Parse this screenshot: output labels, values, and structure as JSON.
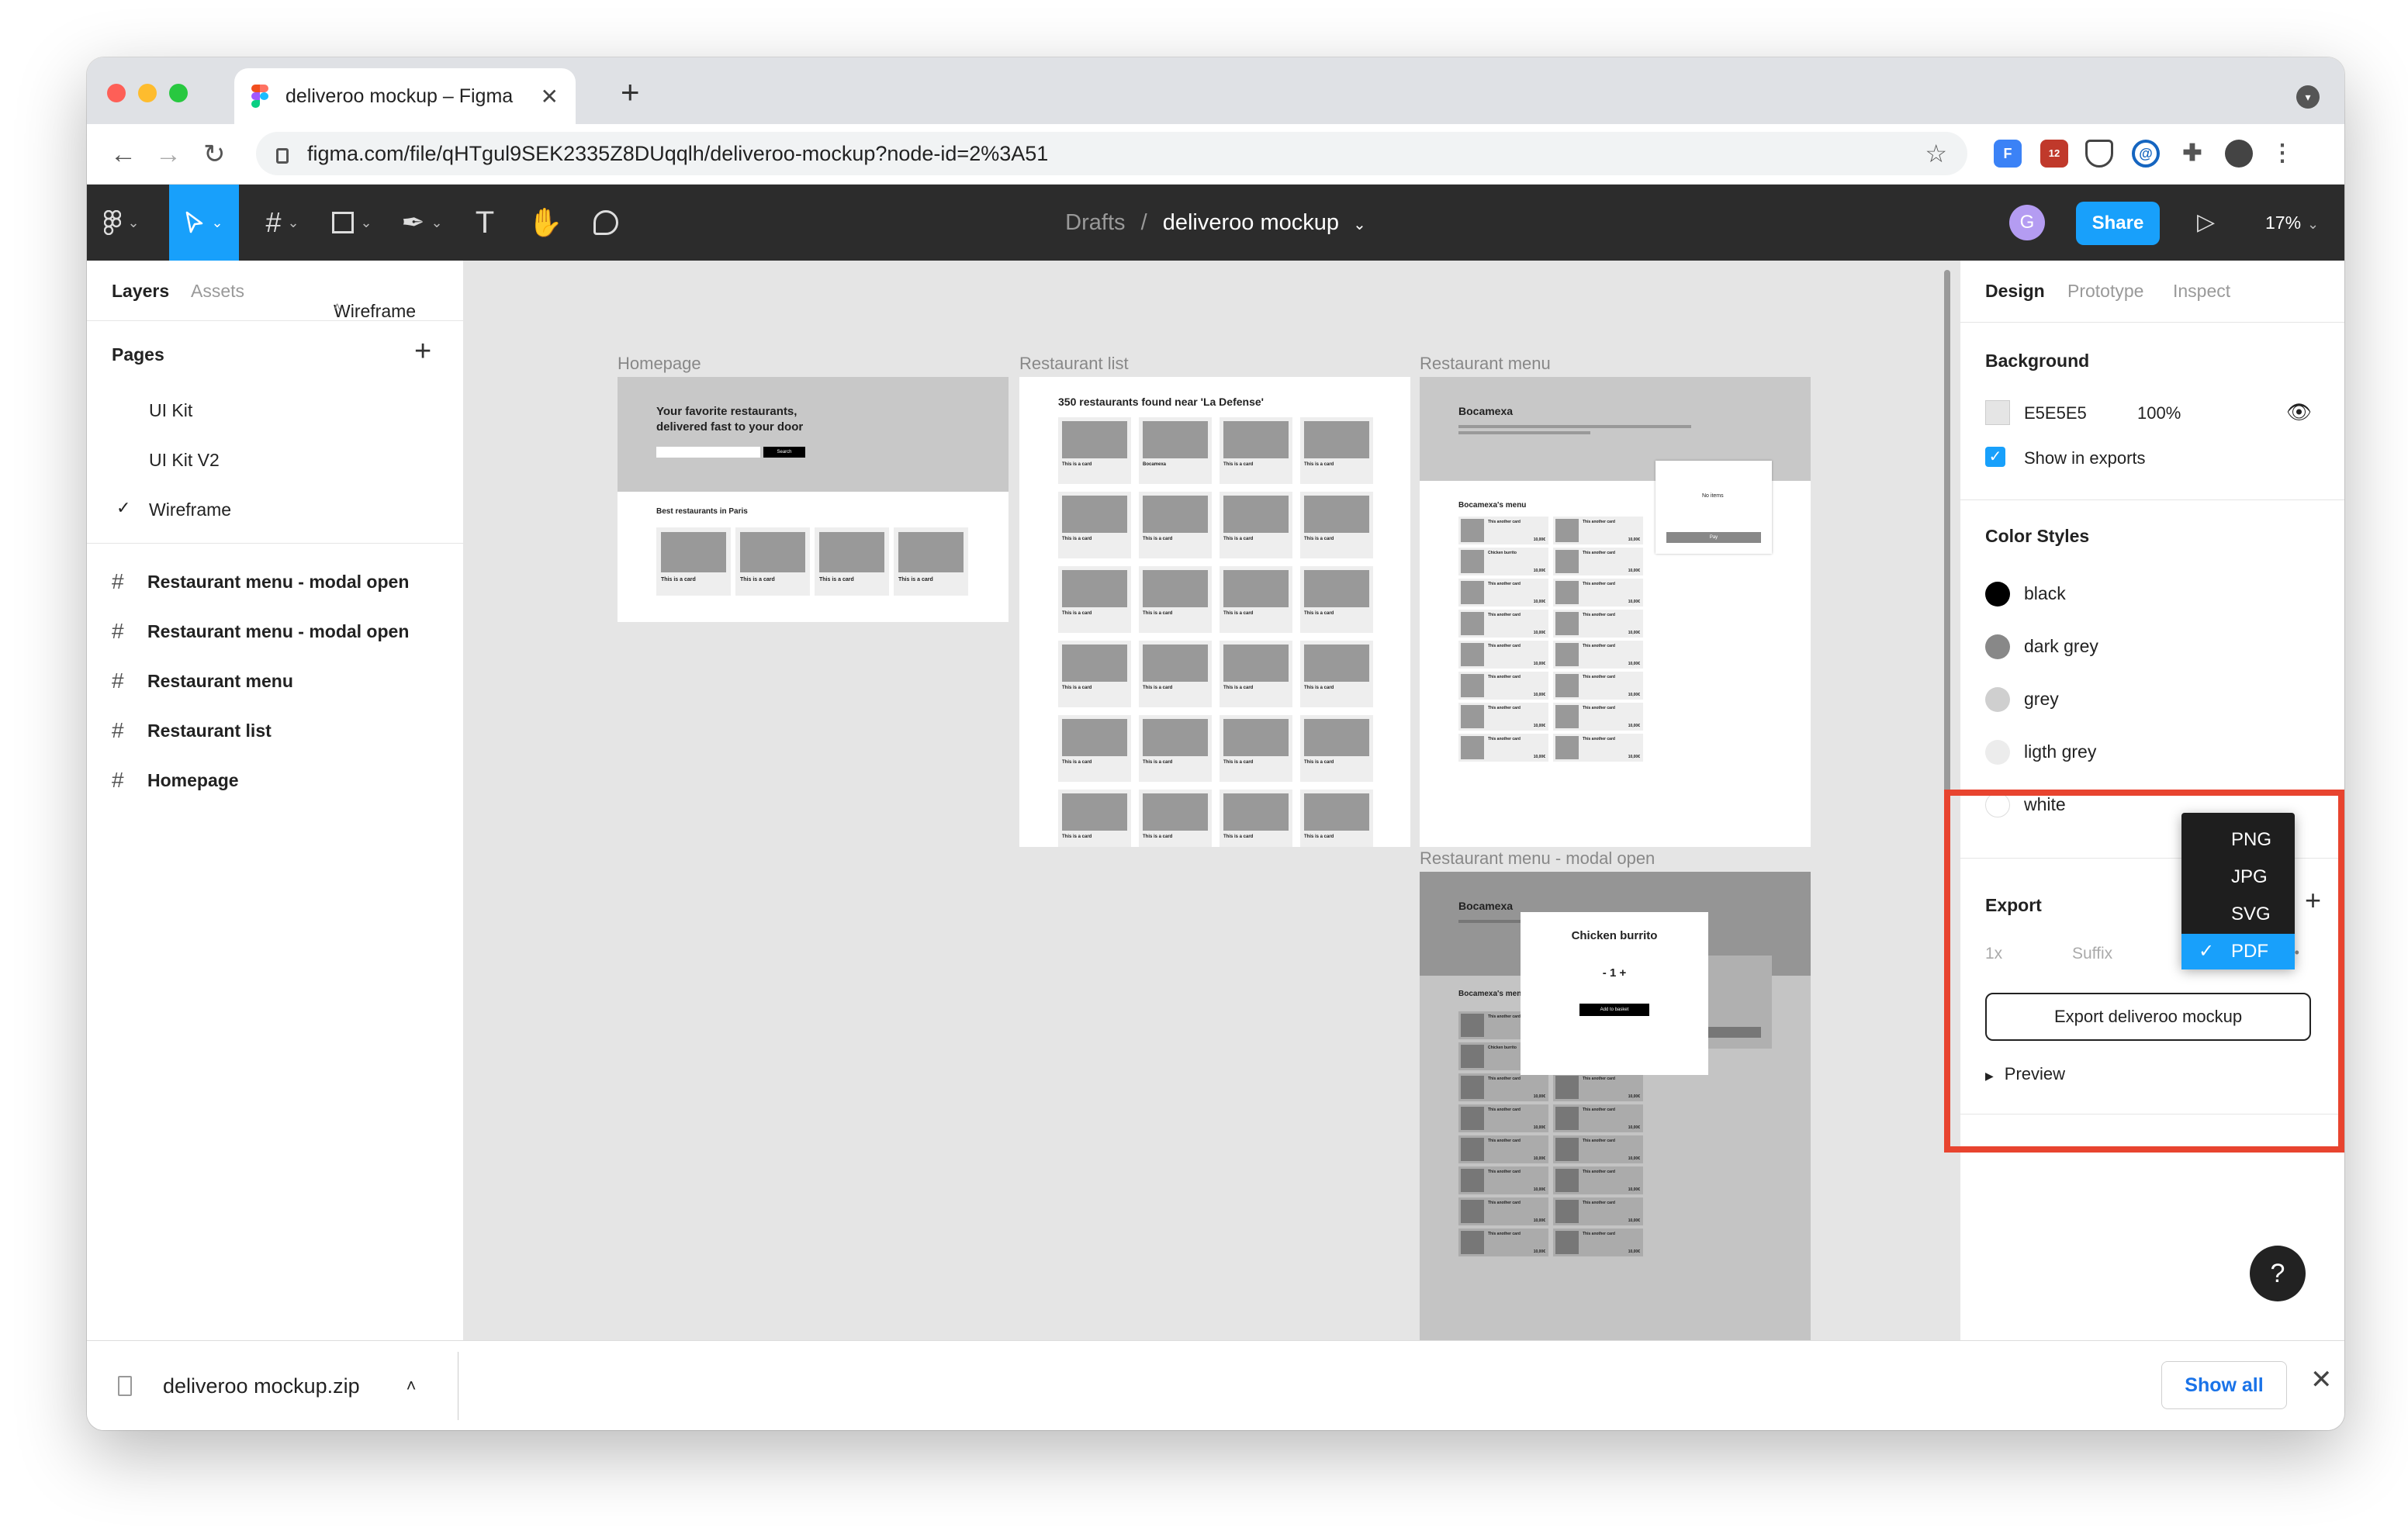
{
  "browser": {
    "tab_title": "deliveroo mockup – Figma",
    "tab_close": "✕",
    "new_tab": "+",
    "url": "figma.com/file/qHTgul9SEK2335Z8DUqqlh/deliveroo-mockup?node-id=2%3A51",
    "extension_badge": "12"
  },
  "toolbar": {
    "drafts": "Drafts",
    "separator": "/",
    "file_name": "deliveroo mockup",
    "avatar_initial": "G",
    "share": "Share",
    "zoom": "17%"
  },
  "left_panel": {
    "tabs": [
      "Layers",
      "Assets"
    ],
    "current_page_label": "Wireframe",
    "pages_title": "Pages",
    "pages": [
      {
        "name": "UI Kit",
        "selected": false
      },
      {
        "name": "UI Kit V2",
        "selected": false
      },
      {
        "name": "Wireframe",
        "selected": true
      }
    ],
    "layers": [
      "Restaurant menu - modal open",
      "Restaurant menu - modal open",
      "Restaurant menu",
      "Restaurant list",
      "Homepage"
    ]
  },
  "canvas": {
    "frames": {
      "homepage": {
        "label": "Homepage",
        "hero_line1": "Your favorite restaurants,",
        "hero_line2": "delivered fast to your door",
        "search_button": "Search",
        "section_title": "Best restaurants in Paris",
        "card_title": "This is a card"
      },
      "restaurant_list": {
        "label": "Restaurant list",
        "heading": "350 restaurants found near 'La Defense'",
        "card_title": "This is a card",
        "card_title_alt": "Bocamexa"
      },
      "restaurant_menu": {
        "label": "Restaurant menu",
        "restaurant_name": "Bocamexa",
        "menu_heading": "Bocamexa's menu",
        "basket_text": "No items",
        "basket_button": "Pay",
        "item_title": "This another card",
        "item_title_alt": "Chicken burrito",
        "price": "10,00€"
      },
      "modal_open": {
        "label": "Restaurant menu - modal open",
        "restaurant_name": "Bocamexa",
        "menu_heading": "Bocamexa's menu",
        "modal_title": "Chicken burrito",
        "stepper": "- 1 +",
        "modal_button": "Add to basket"
      }
    }
  },
  "right_panel": {
    "tabs": [
      "Design",
      "Prototype",
      "Inspect"
    ],
    "background_title": "Background",
    "background_hex": "E5E5E5",
    "background_opacity": "100%",
    "show_in_exports": "Show in exports",
    "color_styles_title": "Color Styles",
    "color_styles": [
      {
        "name": "black",
        "color": "#000000"
      },
      {
        "name": "dark grey",
        "color": "#888888"
      },
      {
        "name": "grey",
        "color": "#cfcfcf"
      },
      {
        "name": "ligth grey",
        "color": "#ececec"
      },
      {
        "name": "white",
        "color": "#ffffff"
      }
    ],
    "export_title": "Export",
    "export_add": "+",
    "scale": "1x",
    "suffix_placeholder": "Suffix",
    "more": "•••",
    "export_button": "Export deliveroo mockup",
    "preview": "Preview"
  },
  "format_dropdown": {
    "options": [
      "PNG",
      "JPG",
      "SVG",
      "PDF"
    ],
    "selected": "PDF"
  },
  "help_button": "?",
  "downloads": {
    "file_name": "deliveroo mockup.zip",
    "show_all": "Show all",
    "close": "✕"
  },
  "colors": {
    "accent": "#18a0fb",
    "highlight": "#e8442f",
    "toolbar": "#2c2c2c",
    "canvas": "#e5e5e5"
  }
}
